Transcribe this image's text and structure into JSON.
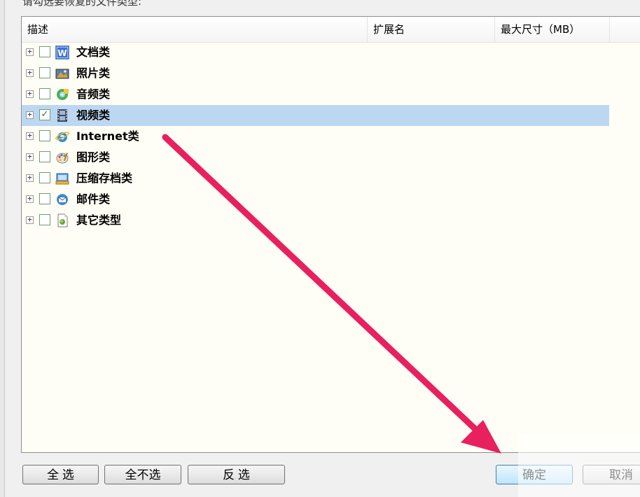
{
  "dialog": {
    "prompt": "请勾选要恢复的文件类型:"
  },
  "columns": {
    "description": "描述",
    "extension": "扩展名",
    "max_size": "最大尺寸（MB）"
  },
  "file_types": [
    {
      "label": "文档类",
      "checked": false,
      "icon": "word-document-icon"
    },
    {
      "label": "照片类",
      "checked": false,
      "icon": "photo-icon"
    },
    {
      "label": "音频类",
      "checked": false,
      "icon": "audio-icon"
    },
    {
      "label": "视频类",
      "checked": true,
      "icon": "video-film-icon",
      "selected": true
    },
    {
      "label": "Internet类",
      "checked": false,
      "icon": "internet-explorer-icon"
    },
    {
      "label": "图形类",
      "checked": false,
      "icon": "graphics-palette-icon"
    },
    {
      "label": "压缩存档类",
      "checked": false,
      "icon": "archive-icon"
    },
    {
      "label": "邮件类",
      "checked": false,
      "icon": "mail-icon"
    },
    {
      "label": "其它类型",
      "checked": false,
      "icon": "other-file-icon"
    }
  ],
  "buttons": {
    "select_all": "全  选",
    "select_none": "全不选",
    "invert": "反  选",
    "ok": "确定",
    "cancel": "取消"
  },
  "colors": {
    "selection": "#bcd7f1",
    "arrow": "#e8205f",
    "list_background": "#fffef6"
  }
}
